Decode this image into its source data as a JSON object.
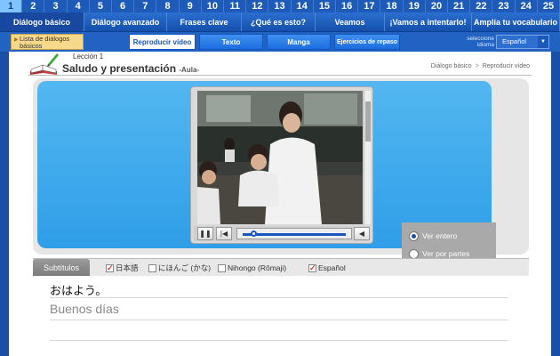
{
  "lessons": [
    "1",
    "2",
    "3",
    "4",
    "5",
    "6",
    "7",
    "8",
    "9",
    "10",
    "11",
    "12",
    "13",
    "14",
    "15",
    "16",
    "17",
    "18",
    "19",
    "20",
    "21",
    "22",
    "23",
    "24",
    "25"
  ],
  "active_lesson": "1",
  "main_nav": [
    "Diálogo básico",
    "Diálogo avanzado",
    "Frases clave",
    "¿Qué es esto?",
    "Veamos",
    "¡Vamos a intentarlo!",
    "Amplía tu vocabulario"
  ],
  "sub_nav": {
    "lista_label": "Lista de diálogos básicos",
    "tabs": [
      "Reproducir vídeo",
      "Texto",
      "Manga",
      "Ejercicios de repaso"
    ],
    "idioma_label": "seleccione idioma",
    "idioma_value": "Español"
  },
  "lesson": {
    "number": "Lección 1",
    "title": "Saludo y presentación",
    "subtitle": "-Aula-"
  },
  "breadcrumb": [
    "Diálogo básico",
    "Reproducir vídeo"
  ],
  "breadcrumb_sep": ">",
  "player": {
    "progress": 0.08
  },
  "view_options": [
    "Ver entero",
    "Ver por partes"
  ],
  "view_selected": "Ver entero",
  "subtitles": {
    "title": "Subtítulos",
    "options": [
      {
        "label": "日本語",
        "checked": true
      },
      {
        "label": "にほんご (かな)",
        "checked": false
      },
      {
        "label": "Nihongo (Rômaji)",
        "checked": false
      },
      {
        "label": "Español",
        "checked": true
      }
    ],
    "japanese": "おはよう。",
    "spanish": "Buenos días"
  },
  "colors": {
    "nav_blue": "#1e5bb8",
    "stage_blue": "#2f9ee8",
    "check_red": "#d9381e"
  }
}
